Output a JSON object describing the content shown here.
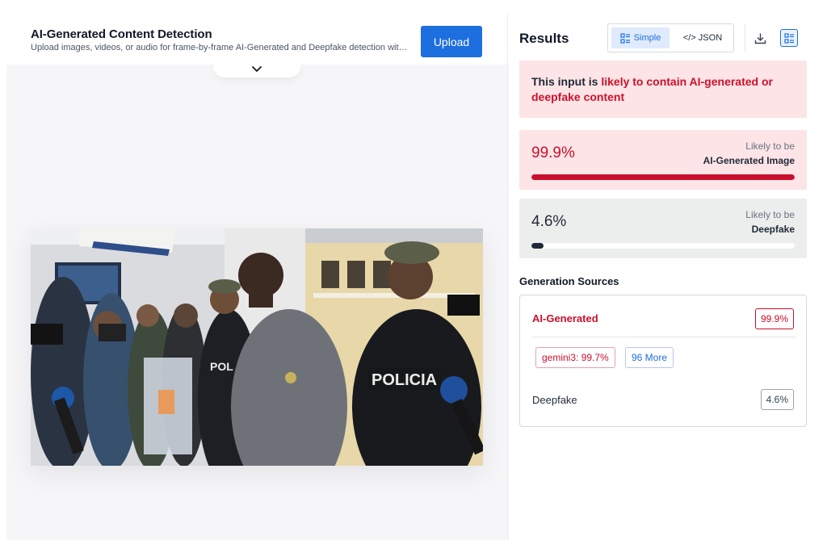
{
  "detector": {
    "title": "AI-Generated Content Detection",
    "subtitle": "Upload images, videos, or audio for frame-by-frame AI-Generated and Deepfake detection with…",
    "upload_label": "Upload"
  },
  "results": {
    "title": "Results",
    "view_toggle": {
      "simple_label": "Simple",
      "json_label": "</> JSON",
      "selected": "Simple"
    },
    "verdict": {
      "prefix": "This input is ",
      "highlight": "likely to contain AI-generated or deepfake content"
    },
    "ai_card": {
      "percent_text": "99.9%",
      "percent_value": 99.9,
      "label_top": "Likely to be",
      "label_main": "AI-Generated Image"
    },
    "deepfake_card": {
      "percent_text": "4.6%",
      "percent_value": 4.6,
      "label_top": "Likely to be",
      "label_main": "Deepfake"
    },
    "generation_sources": {
      "title": "Generation Sources",
      "ai_label": "AI-Generated",
      "ai_value": "99.9%",
      "model_chip": "gemini3: 99.7%",
      "more_chip": "96 More",
      "deepfake_label": "Deepfake",
      "deepfake_value": "4.6%"
    }
  },
  "colors": {
    "accent": "#1d6fe0",
    "alert": "#c8102e",
    "alert_bg": "#fde4e6"
  },
  "icons": [
    "chevron-down-icon",
    "simple-view-icon",
    "download-icon",
    "list-view-icon"
  ]
}
